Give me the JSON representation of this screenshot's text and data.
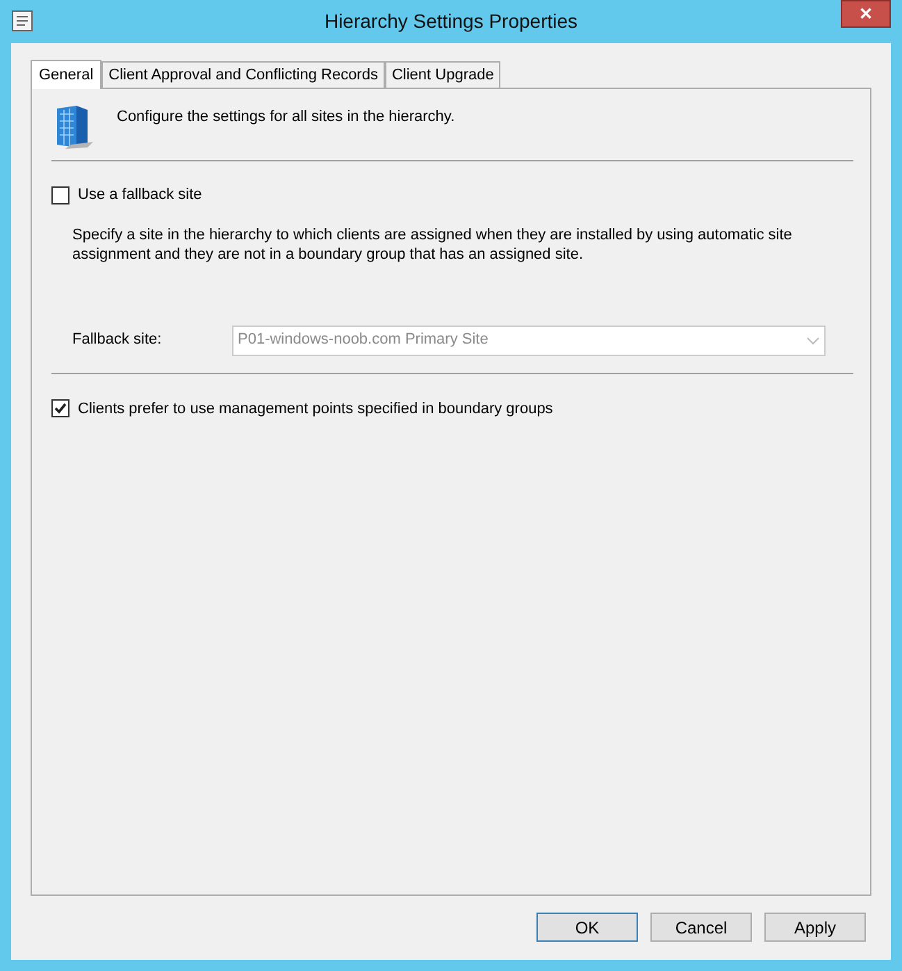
{
  "window": {
    "title": "Hierarchy Settings Properties",
    "close": "✕"
  },
  "tabs": [
    {
      "label": "General",
      "selected": true
    },
    {
      "label": "Client Approval and Conflicting Records",
      "selected": false
    },
    {
      "label": "Client Upgrade",
      "selected": false
    }
  ],
  "header": {
    "text": "Configure the settings for all sites in the hierarchy."
  },
  "fallback": {
    "label": "Use a fallback site",
    "checked": false,
    "description": "Specify a site in the hierarchy to which clients are assigned when they are installed by using automatic site assignment and they are not in a boundary group that has an assigned site.",
    "field_label": "Fallback site:",
    "value": "P01-windows-noob.com Primary Site",
    "disabled": true
  },
  "prefer_mp": {
    "label": "Clients prefer to use management points specified in boundary groups",
    "checked": true
  },
  "buttons": [
    {
      "label": "OK",
      "default": true
    },
    {
      "label": "Cancel",
      "default": false
    },
    {
      "label": "Apply",
      "default": false
    }
  ]
}
